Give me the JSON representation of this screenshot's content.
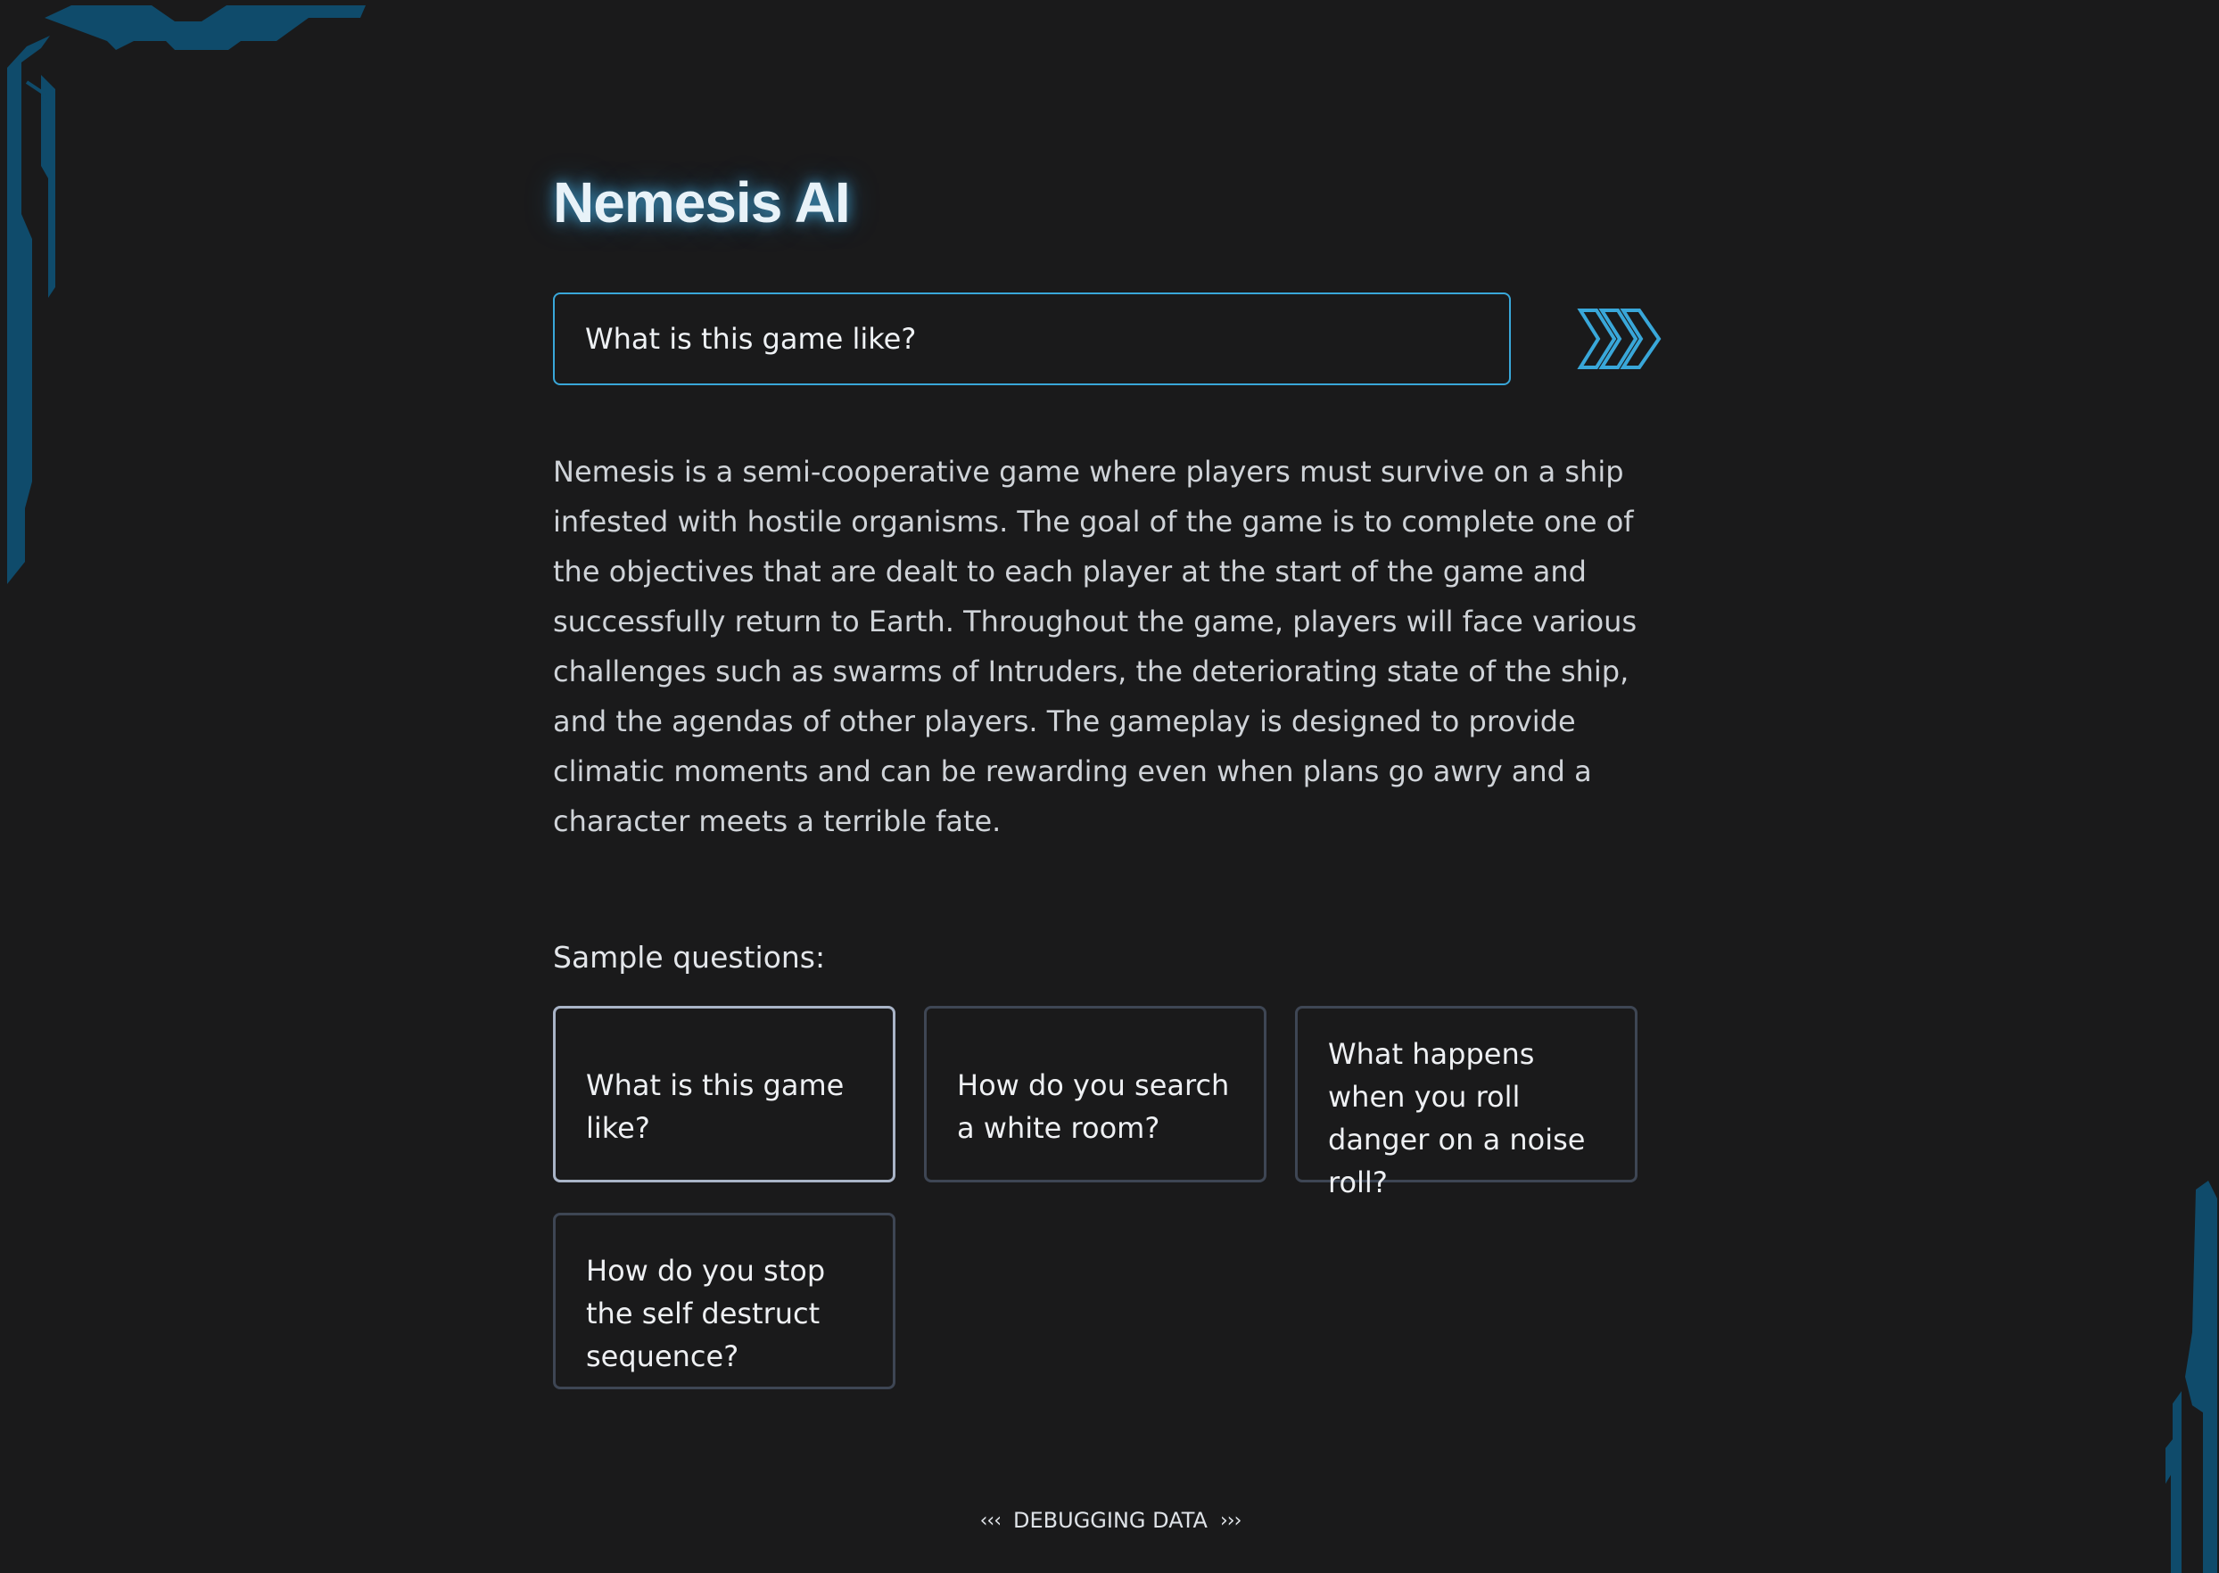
{
  "app": {
    "title": "Nemesis AI"
  },
  "query": {
    "value": "What is this game like?",
    "submit_icon": "triple-chevron-right-icon"
  },
  "answer": {
    "text": "Nemesis is a semi-cooperative game where players must survive on a ship infested with hostile organisms. The goal of the game is to complete one of the objectives that are dealt to each player at the start of the game and successfully return to Earth. Throughout the game, players will face various challenges such as swarms of Intruders, the deteriorating state of the ship, and the agendas of other players. The gameplay is designed to provide climatic moments and can be rewarding even when plans go awry and a character meets a terrible fate."
  },
  "samples": {
    "label": "Sample questions:",
    "questions": [
      "What is this game like?",
      "How do you search a white room?",
      "What happens when you roll danger on a noise roll?",
      "How do you stop the self destruct sequence?"
    ],
    "selected_index": 0
  },
  "debug": {
    "left_arrows": "‹‹‹",
    "label": "DEBUGGING DATA",
    "right_arrows": "›››"
  },
  "colors": {
    "background": "#1a1a1b",
    "accent": "#39a7d9",
    "decoration": "#0f4b6b",
    "card_border": "#3e4654",
    "card_border_selected": "#a9b4c7"
  }
}
